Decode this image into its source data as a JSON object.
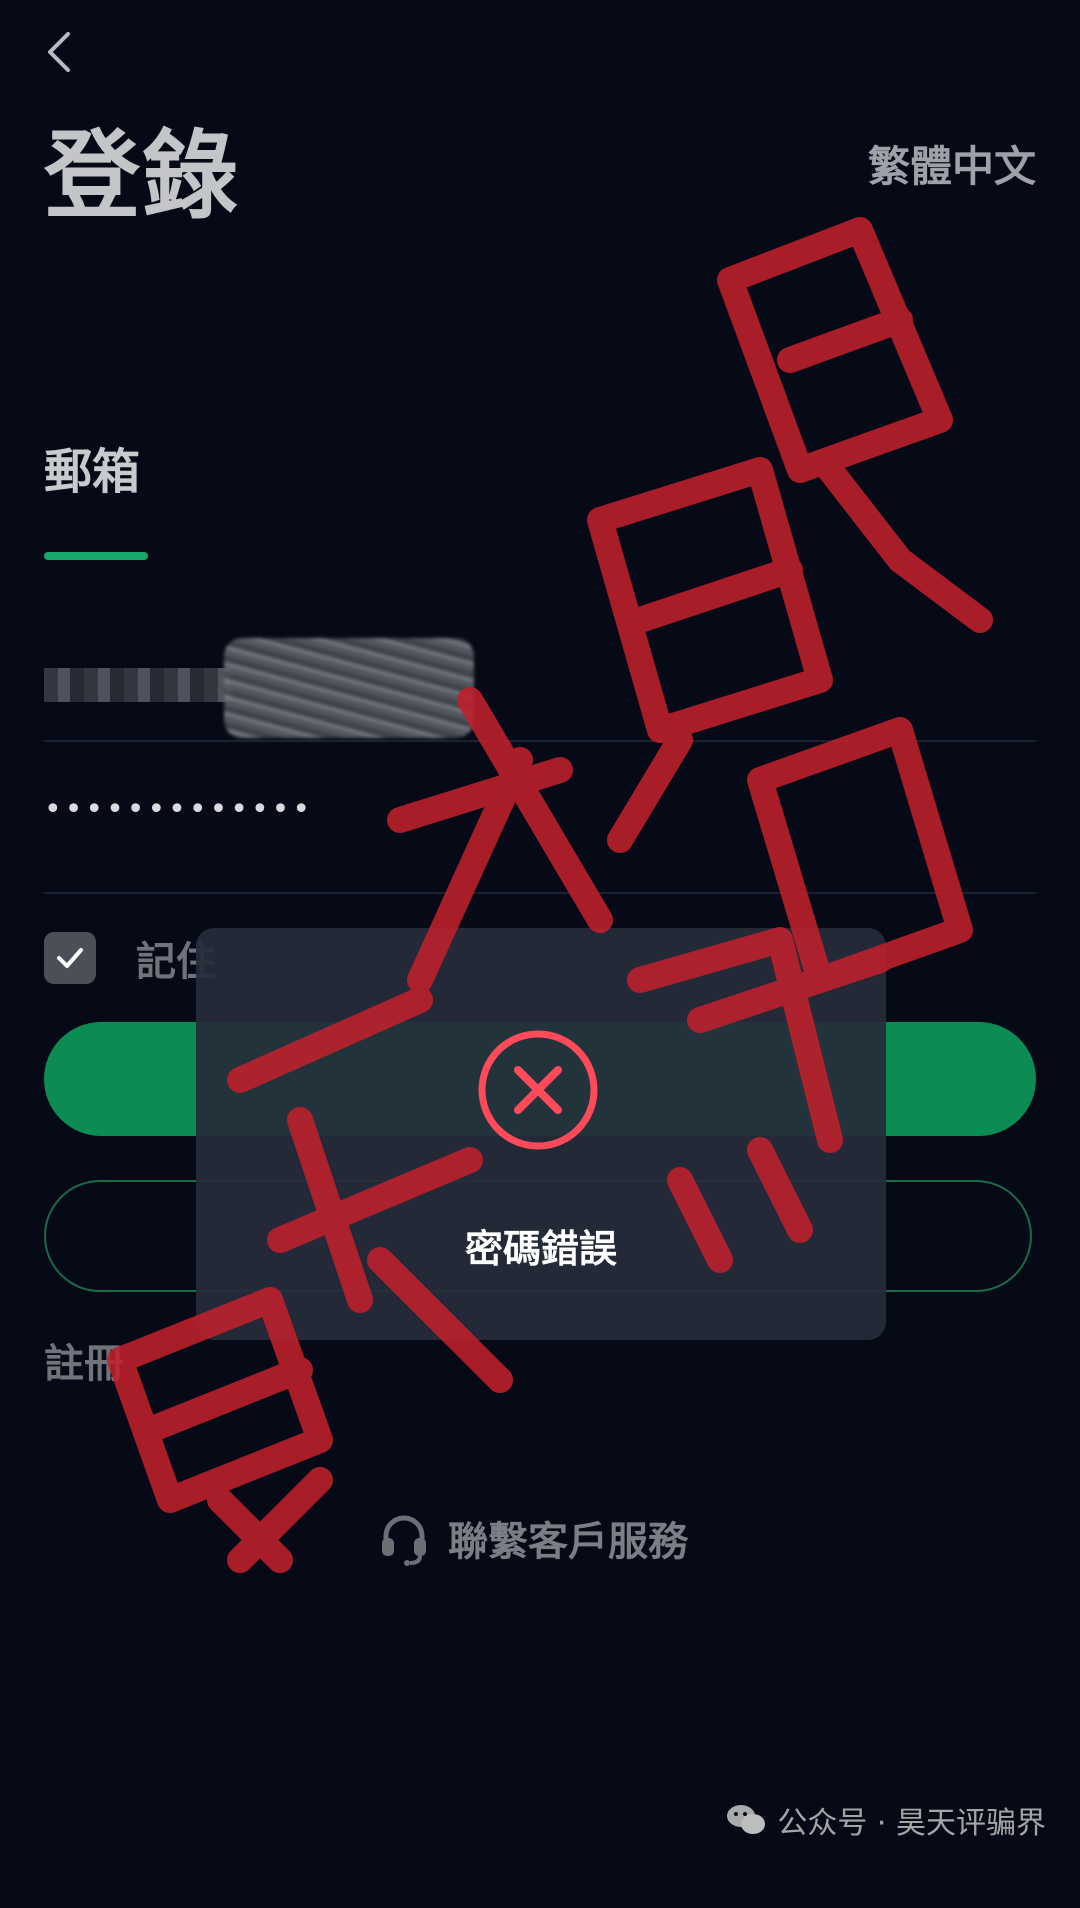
{
  "header": {
    "back_icon": "chevron-left-icon",
    "title": "登錄",
    "language": "繁體中文"
  },
  "login_tabs": {
    "active_tab": "郵箱"
  },
  "form": {
    "email_value": "(blurred)",
    "password_masked": "•••••••••••••",
    "remember_label": "記住",
    "remember_checked": true
  },
  "links": {
    "register": "註冊",
    "support": "聯繫客戶服務",
    "support_icon": "headset-icon"
  },
  "toast": {
    "icon": "error-x-icon",
    "message": "密碼錯誤"
  },
  "stamp": {
    "text": "昊天评骗界",
    "color": "#c0202c"
  },
  "watermark": {
    "text": "公众号 · 昊天评骗界"
  },
  "colors": {
    "background": "#060a16",
    "accent_green": "#0c8c52",
    "tab_underline": "#18a86a"
  }
}
